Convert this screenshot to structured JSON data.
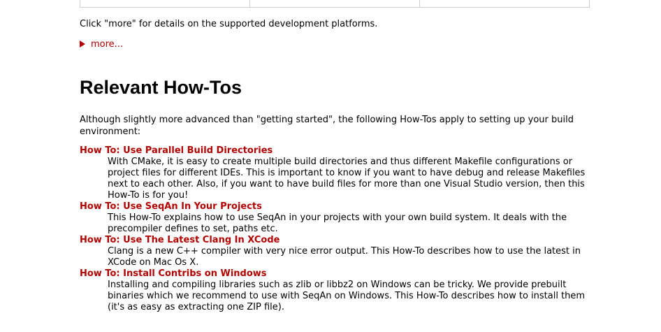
{
  "intro_line": "Click \"more\" for details on the supported development platforms.",
  "more_link": "more...",
  "section_title": "Relevant How-Tos",
  "section_intro": "Although slightly more advanced than \"getting started\", the following How-Tos apply to setting up your build environment:",
  "howtos": [
    {
      "title": "How To: Use Parallel Build Directories",
      "description": "With CMake, it is easy to create multiple build directories and thus different Makefile configurations or project files for different IDEs. This is important to know if you want to have debug and release Makefiles next to each other. Also, if you want to have build files for more than one Visual Studio version, then this How-To is for you!"
    },
    {
      "title": "How To: Use SeqAn In Your Projects",
      "description": "This How-To explains how to use SeqAn in your projects with your own build system. It deals with the precompiler defines to set, paths etc."
    },
    {
      "title": "How To: Use The Latest Clang In XCode",
      "description": "Clang is a new C++ compiler with very nice error output. This How-To describes how to use the latest in XCode on Mac Os X."
    },
    {
      "title": "How To: Install Contribs on Windows",
      "description": "Installing and compiling libraries such as zlib or libbz2 on Windows can be tricky. We provide prebuilt binaries which we recommend to use with SeqAn on Windows. This How-To describes how to install them (it's as easy as extracting one ZIP file)."
    }
  ],
  "colors": {
    "link": "#b30000",
    "text": "#000000",
    "table_border": "#cfcfcf"
  },
  "icons": {
    "more_marker": "triangle-right-icon"
  }
}
